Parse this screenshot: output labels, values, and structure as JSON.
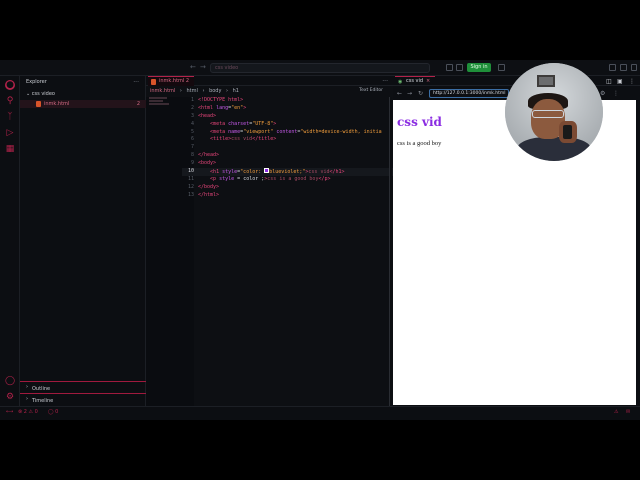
{
  "titlebar": {
    "nav_back": "←",
    "nav_forward": "→",
    "search_text": "css video",
    "signin_label": "Sign in"
  },
  "activity": {
    "icons": [
      "explorer-icon",
      "search-icon",
      "source-control-icon",
      "run-debug-icon",
      "extensions-icon",
      "account-icon",
      "settings-icon"
    ]
  },
  "explorer": {
    "title": "Explorer",
    "more": "...",
    "folder": "css video",
    "file_name": "inmk.html",
    "file_count": "2",
    "outline_label": "Outline",
    "timeline_label": "Timeline"
  },
  "editor": {
    "tab_label": "inmk.html 2",
    "more": "...",
    "breadcrumb": [
      "inmk.html",
      "html",
      "body",
      "h1"
    ],
    "text_editor_label": "Text Editor",
    "lines": [
      {
        "n": "1",
        "html": "<span class=\"tag\">&lt;!DOCTYPE html&gt;</span>"
      },
      {
        "n": "2",
        "html": "<span class=\"tag\">&lt;html</span> <span class=\"attr\">lang</span>=<span class=\"str\">\"en\"</span><span class=\"tag\">&gt;</span>"
      },
      {
        "n": "3",
        "html": "<span class=\"tag\">&lt;head&gt;</span>"
      },
      {
        "n": "4",
        "html": "    <span class=\"tag\">&lt;meta</span> <span class=\"attr\">charset</span>=<span class=\"str\">\"UTF-8\"</span><span class=\"tag\">&gt;</span>"
      },
      {
        "n": "5",
        "html": "    <span class=\"tag\">&lt;meta</span> <span class=\"attr\">name</span>=<span class=\"str\">\"viewport\"</span> <span class=\"attr\">content</span>=<span class=\"str\">\"width=device-width, initia</span>"
      },
      {
        "n": "6",
        "html": "    <span class=\"tag\">&lt;title&gt;</span><span class=\"dim\">css vid</span><span class=\"tag\">&lt;/title&gt;</span>"
      },
      {
        "n": "7",
        "html": ""
      },
      {
        "n": "8",
        "html": "<span class=\"tag\">&lt;/head&gt;</span>"
      },
      {
        "n": "9",
        "html": "<span class=\"tag\">&lt;body&gt;</span>"
      },
      {
        "n": "10",
        "html": "    <span class=\"tag\">&lt;h1</span> <span class=\"attr\">style</span>=<span class=\"str\">\"color: </span><span style=\"display:inline-block;width:5px;height:5px;background:#8a2be2;border:1px solid #fff;\"></span><span class=\"str\">blueviolet;\"</span><span class=\"tag\">&gt;</span><span class=\"dim\">css vid</span><span class=\"tag\">&lt;/h1&gt;</span>",
        "active": true
      },
      {
        "n": "11",
        "html": "    <span class=\"tag\">&lt;p</span> <span class=\"attr\">style</span> = <span class=\"txt\">color ;</span><span class=\"tag\">&gt;</span><span class=\"dim\">css is a good boy</span><span class=\"tag\">&lt;/p&gt;</span>"
      },
      {
        "n": "12",
        "html": "<span class=\"tag\">&lt;/body&gt;</span>"
      },
      {
        "n": "13",
        "html": "<span class=\"tag\">&lt;/html&gt;</span>"
      }
    ]
  },
  "preview": {
    "tab_label": "css vid",
    "tab_close": "×",
    "url": "http://127.0.0.1:3000/inmk.html",
    "heading": "css vid",
    "paragraph": "css is a good boy",
    "heading_color": "#8a2be2"
  },
  "statusbar": {
    "errors": "⊗ 2 ⚠ 0",
    "ports": "◯ 0"
  },
  "colors": {
    "accent": "#b3224a",
    "signin": "#1f8f3a"
  }
}
